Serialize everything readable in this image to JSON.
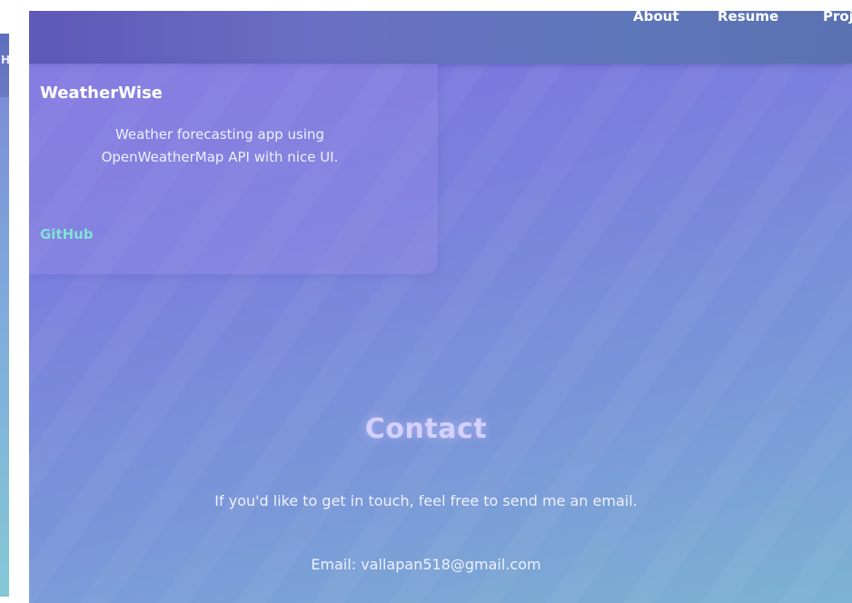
{
  "left_window": {
    "visible_letter": "H"
  },
  "nav": {
    "about": "About",
    "resume": "Resume",
    "projects": "Proj"
  },
  "project_card": {
    "title": "WeatherWise",
    "description": "Weather forecasting app using OpenWeatherMap API with nice UI.",
    "link_label": "GitHub"
  },
  "contact": {
    "title": "Contact",
    "text": "If you'd like to get in touch, feel free to send me an email.",
    "email": "Email: vallapan518@gmail.com"
  },
  "colors": {
    "accent_link": "#7fe3d8",
    "heading_glow": "#d4d0ff"
  }
}
